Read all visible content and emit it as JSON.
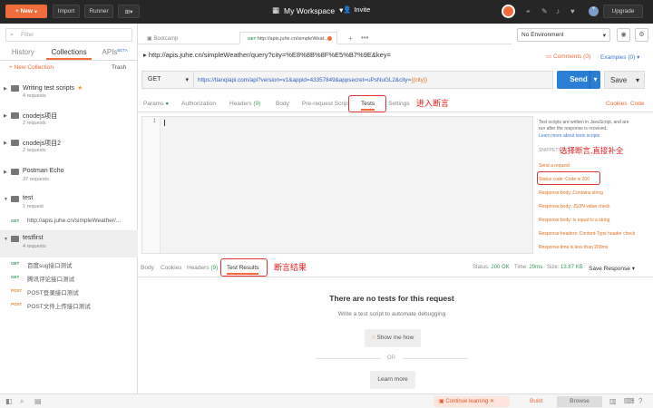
{
  "topbar": {
    "new_label": "New",
    "import_label": "Import",
    "runner_label": "Runner",
    "workspace_label": "My Workspace",
    "invite_label": "Invite",
    "upgrade_label": "Upgrade"
  },
  "sidebar": {
    "filter_placeholder": "Filter",
    "tabs": [
      "History",
      "Collections",
      "APIs"
    ],
    "apis_badge": "BETA",
    "new_collection": "+ New Collection",
    "trash": "Trash",
    "collections": [
      {
        "name": "Writing test scripts",
        "count": "4 requests"
      },
      {
        "name": "cnodejs项目",
        "count": "2 requests"
      },
      {
        "name": "cnodejs项目2",
        "count": "2 requests"
      },
      {
        "name": "Postman Echo",
        "count": "37 requests"
      },
      {
        "name": "test",
        "count": "1 request"
      },
      {
        "name": "testfirst",
        "count": "4 requests"
      }
    ],
    "test_request": {
      "method": "GET",
      "title": "http://apis.juhe.cn/simpleWeather/..."
    },
    "testfirst_requests": [
      {
        "method": "GET",
        "title": "百度sug接口测试"
      },
      {
        "method": "GET",
        "title": "腾讯评论接口测试"
      },
      {
        "method": "POST",
        "title": "POST登录接口测试"
      },
      {
        "method": "POST",
        "title": "POST文件上传接口测试"
      }
    ]
  },
  "tabs": {
    "tab1": "Bootcamp",
    "tab2_method": "GET",
    "tab2_title": "http://apis.juhe.cn/simpleWeat..."
  },
  "environment": {
    "selected": "No Environment"
  },
  "request": {
    "title": "http://apis.juhe.cn/simpleWeather/query?city=%E8%8B%8F%E5%B7%9E&key=",
    "comments": "Comments (0)",
    "examples": "Examples (0)",
    "method": "GET",
    "url_prefix": "https://tianqiapi.com/api?version=v1&appid=43357849&appsecret=uPsNuGL2&city=",
    "url_var": "{{city}}",
    "send": "Send",
    "save": "Save"
  },
  "request_tabs": {
    "params": "Params",
    "authorization": "Authorization",
    "headers": "Headers",
    "headers_count": "(9)",
    "body": "Body",
    "prerequest": "Pre-request Script",
    "tests": "Tests",
    "settings": "Settings",
    "cookies": "Cookies",
    "code": "Code"
  },
  "editor": {
    "line": "1"
  },
  "snippets": {
    "intro1": "Test scripts are written in JavaScript, and are",
    "intro2": "run after the response is received.",
    "learn": "Learn more about tests scripts",
    "heading": "SNIPPETS",
    "items": [
      "Send a request",
      "Status code: Code is 200",
      "Response body: Contains string",
      "Response body: JSON value check",
      "Response body: Is equal to a string",
      "Response headers: Content-Type header check",
      "Response time is less than 200ms"
    ]
  },
  "response": {
    "tabs": [
      "Body",
      "Cookies",
      "Headers",
      "Test Results"
    ],
    "headers_count": "(9)",
    "status_label": "Status:",
    "status_value": "200 OK",
    "time_label": "Time:",
    "time_value": "29ms",
    "size_label": "Size:",
    "size_value": "13.87 KB",
    "save_response": "Save Response",
    "no_tests": "There are no tests for this request",
    "write_test": "Write a test script to automate debugging",
    "show_me": "Show me how",
    "or": "OR",
    "learn_more": "Learn more"
  },
  "annotations": {
    "tests": "进入断言",
    "snippets": "选择断言,直接补全",
    "results": "断言结果"
  },
  "statusbar": {
    "continue_learning": "Continue learning",
    "build": "Build",
    "browse": "Browse"
  },
  "colors": {
    "accent": "#f26b3a",
    "send": "#2a7fd4",
    "annotation": "#e02020"
  }
}
